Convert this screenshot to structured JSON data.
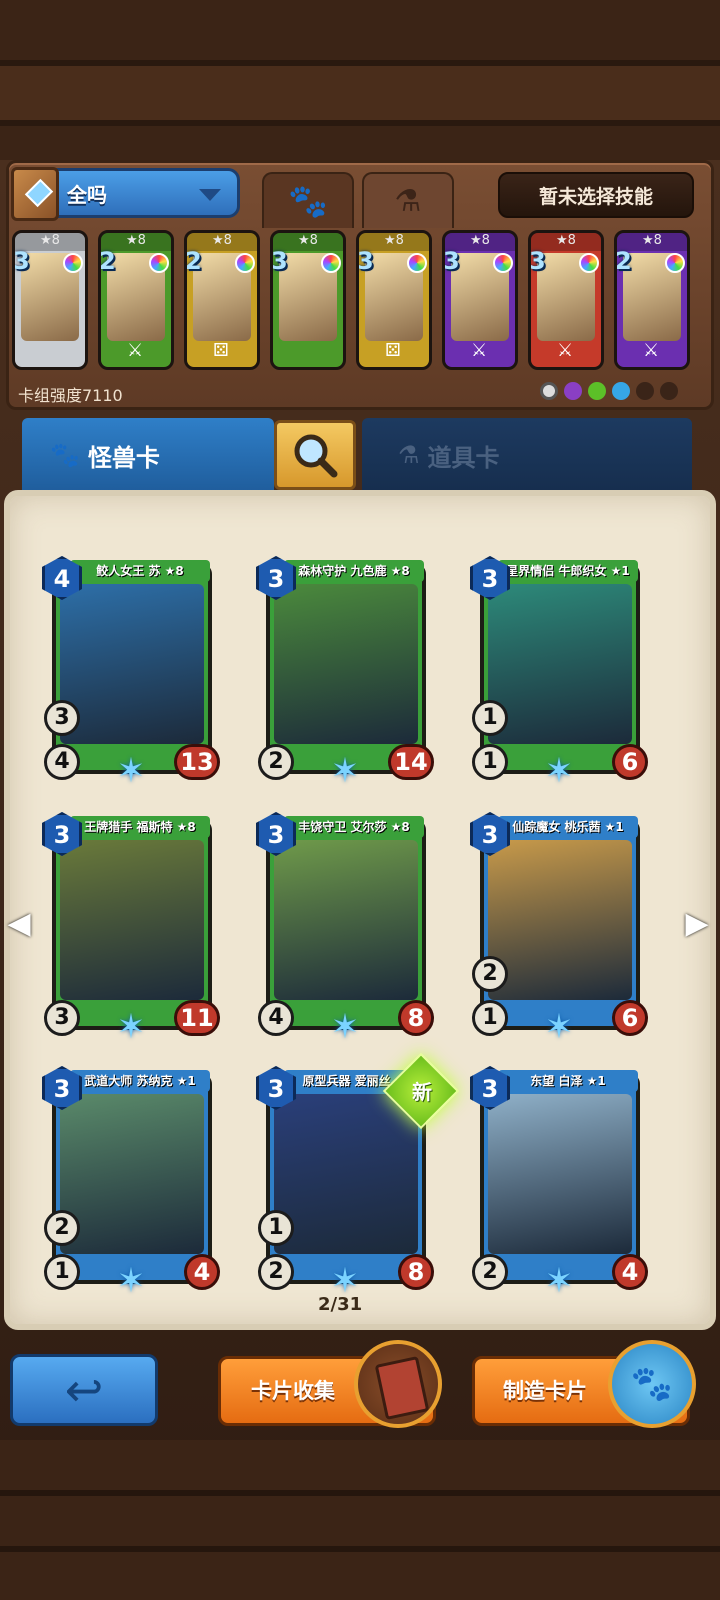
{
  "header": {
    "deck_name": "全吗",
    "skill_button": "暂未选择技能",
    "tab_monster_icon": "paw-icon",
    "tab_item_icon": "potion-icon"
  },
  "deck": {
    "cards": [
      {
        "star": "★8",
        "cost": "3",
        "color": "#c9cdd2",
        "bottom": ""
      },
      {
        "star": "★8",
        "cost": "2",
        "color": "#4c9a2a",
        "bottom": "⚔"
      },
      {
        "star": "★8",
        "cost": "2",
        "color": "#c7a024",
        "bottom": "⚄"
      },
      {
        "star": "★8",
        "cost": "3",
        "color": "#4c9a2a",
        "bottom": ""
      },
      {
        "star": "★8",
        "cost": "3",
        "color": "#c7a024",
        "bottom": "⚄"
      },
      {
        "star": "★8",
        "cost": "3",
        "color": "#6b2fb0",
        "bottom": "⚔"
      },
      {
        "star": "★8",
        "cost": "3",
        "color": "#c53a2a",
        "bottom": "⚔"
      },
      {
        "star": "★8",
        "cost": "2",
        "color": "#6b2fb0",
        "bottom": "⚔"
      }
    ],
    "strength": "卡组强度7110"
  },
  "categories": {
    "monster": "怪兽卡",
    "item": "道具卡"
  },
  "cards": [
    {
      "name": "鲛人女王 苏 ★8",
      "cost": "4",
      "atk": "4",
      "hp": "13",
      "extra": "3",
      "color": "#3aa03a",
      "art": "#2d6fa8"
    },
    {
      "name": "森林守护 九色鹿 ★8",
      "cost": "3",
      "atk": "2",
      "hp": "14",
      "extra": "",
      "color": "#3aa03a",
      "art": "#4b8a3c"
    },
    {
      "name": "星界情侣 牛郎织女 ★1",
      "cost": "3",
      "atk": "1",
      "hp": "6",
      "extra": "1",
      "color": "#3aa03a",
      "art": "#2d8a7a"
    },
    {
      "name": "王牌猎手 福斯特 ★8",
      "cost": "3",
      "atk": "3",
      "hp": "11",
      "extra": "",
      "color": "#3aa03a",
      "art": "#6a7a3a"
    },
    {
      "name": "丰饶守卫 艾尔莎 ★8",
      "cost": "3",
      "atk": "4",
      "hp": "8",
      "extra": "",
      "color": "#3aa03a",
      "art": "#6f9a4a"
    },
    {
      "name": "仙踪魔女 桃乐茜 ★1",
      "cost": "3",
      "atk": "1",
      "hp": "6",
      "extra": "2",
      "color": "#2f7fc8",
      "art": "#c89a4a"
    },
    {
      "name": "武道大师 苏纳克 ★1",
      "cost": "3",
      "atk": "1",
      "hp": "4",
      "extra": "2",
      "color": "#2f7fc8",
      "art": "#5a8a6a"
    },
    {
      "name": "原型兵器 爱丽丝 ★",
      "cost": "3",
      "atk": "2",
      "hp": "8",
      "extra": "1",
      "color": "#2f7fc8",
      "art": "#2a3f7a"
    },
    {
      "name": "东望 白泽 ★1",
      "cost": "3",
      "atk": "2",
      "hp": "4",
      "extra": "",
      "color": "#2f7fc8",
      "art": "#8fb0c8"
    }
  ],
  "new_badge": "新",
  "pager": "2/31",
  "buttons": {
    "back_icon": "back-arrow-icon",
    "collect": "卡片收集",
    "craft": "制造卡片"
  }
}
